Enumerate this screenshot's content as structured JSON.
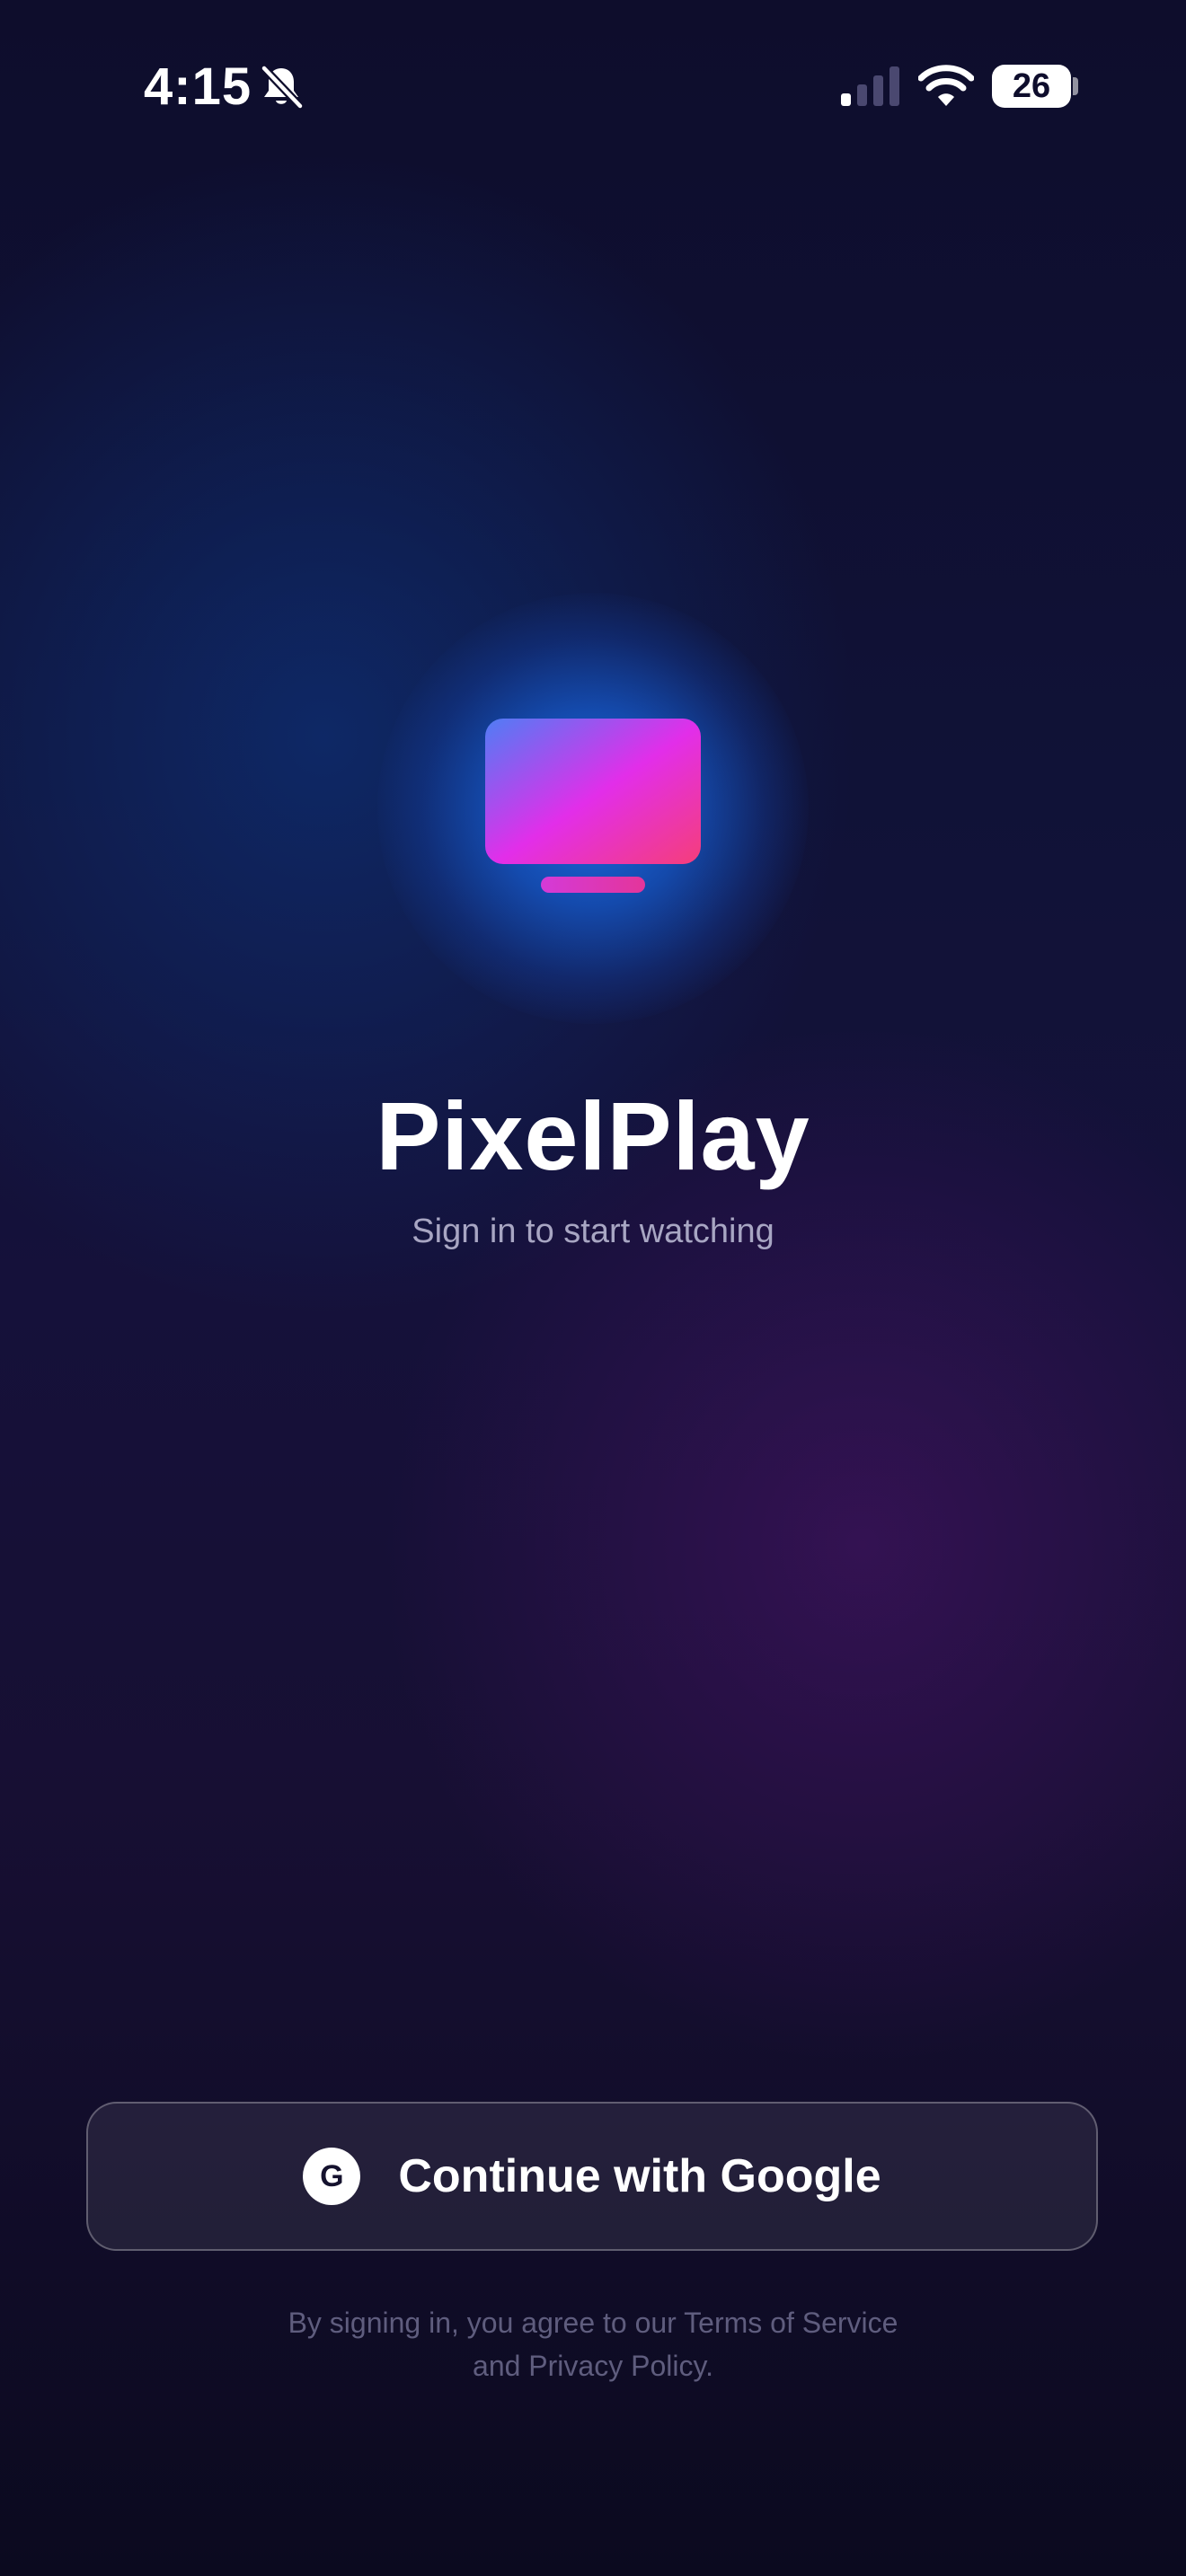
{
  "status_bar": {
    "time": "4:15",
    "battery": "26",
    "icons": [
      "bell-off-icon",
      "signal-icon",
      "wifi-icon",
      "battery-icon"
    ]
  },
  "logo": {
    "icon": "tv-icon",
    "gradient_colors": [
      "#4f7df5",
      "#e22ee9",
      "#f53e7a"
    ]
  },
  "app": {
    "title": "PixelPlay",
    "subtitle": "Sign in to start watching"
  },
  "auth": {
    "google_icon_letter": "G",
    "google_button_label": "Continue with Google"
  },
  "legal": {
    "line1": "By signing in, you agree to our Terms of Service",
    "line2": "and Privacy Policy."
  },
  "colors": {
    "background_top": "#0e0d2c",
    "background_bottom": "#0b0a1f",
    "glow": "#1c70eb",
    "subtitle_text": "#a8a6c3",
    "legal_text": "#5f5d7e"
  }
}
